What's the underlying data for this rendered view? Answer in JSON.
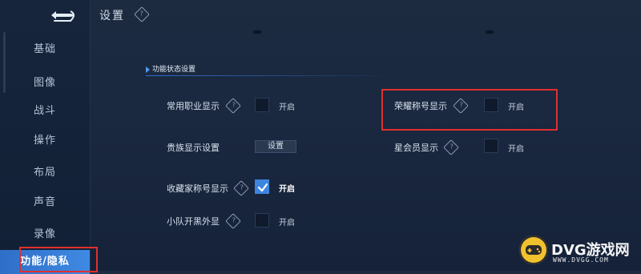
{
  "header": {
    "title": "设置"
  },
  "sidebar": {
    "items": [
      {
        "label": "基础"
      },
      {
        "label": "图像"
      },
      {
        "label": "战斗"
      },
      {
        "label": "操作"
      },
      {
        "label": "布局"
      },
      {
        "label": "声音"
      },
      {
        "label": "录像"
      },
      {
        "label": "功能/隐私",
        "active": true
      }
    ]
  },
  "section": {
    "title": "功能状态设置"
  },
  "settings": {
    "common_job": {
      "label": "常用职业显示",
      "state": "开启",
      "checked": false
    },
    "clan": {
      "label": "贵族显示设置",
      "button": "设置"
    },
    "collector": {
      "label": "收藏家称号显示",
      "state": "开启",
      "checked": true
    },
    "team_boost": {
      "label": "小队开黑外显",
      "state": "开启",
      "checked": false
    },
    "honor_title": {
      "label": "荣耀称号显示",
      "state": "开启",
      "checked": false
    },
    "star_member": {
      "label": "星会员显示",
      "state": "开启",
      "checked": false
    }
  },
  "watermark": {
    "brand": "DVG游戏网",
    "site": "WWW.DVGG.COM"
  },
  "colors": {
    "accent": "#3d86e0",
    "highlight": "#e0302c",
    "background": "#1a2840"
  }
}
